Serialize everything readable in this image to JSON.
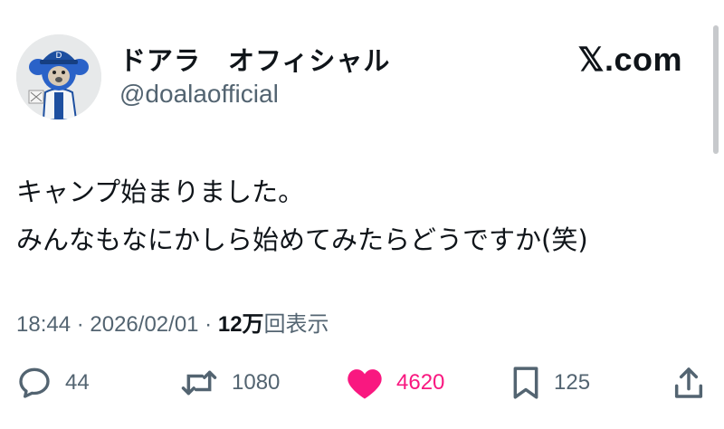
{
  "account": {
    "display_name": "ドアラ　オフィシャル",
    "handle": "@doalaofficial",
    "avatar_icon": "doala-mascot-avatar"
  },
  "brand": {
    "label": "𝕏.com"
  },
  "tweet": {
    "lines": [
      "キャンプ始まりました。",
      "みんなもなにかしら始めてみたらどうですか(笑)"
    ]
  },
  "meta": {
    "time": "18:44",
    "separator": " · ",
    "date": "2026/02/01",
    "views_count": "12万",
    "views_label": "回表示"
  },
  "actions": {
    "replies": {
      "icon": "reply-icon",
      "count": "44"
    },
    "retweets": {
      "icon": "retweet-icon",
      "count": "1080"
    },
    "likes": {
      "icon": "heart-icon",
      "count": "4620",
      "liked": true,
      "color": "#f91880"
    },
    "bookmarks": {
      "icon": "bookmark-icon",
      "count": "125"
    },
    "share": {
      "icon": "share-icon"
    }
  },
  "colors": {
    "text": "#0f1419",
    "secondary": "#536471",
    "like": "#f91880"
  }
}
